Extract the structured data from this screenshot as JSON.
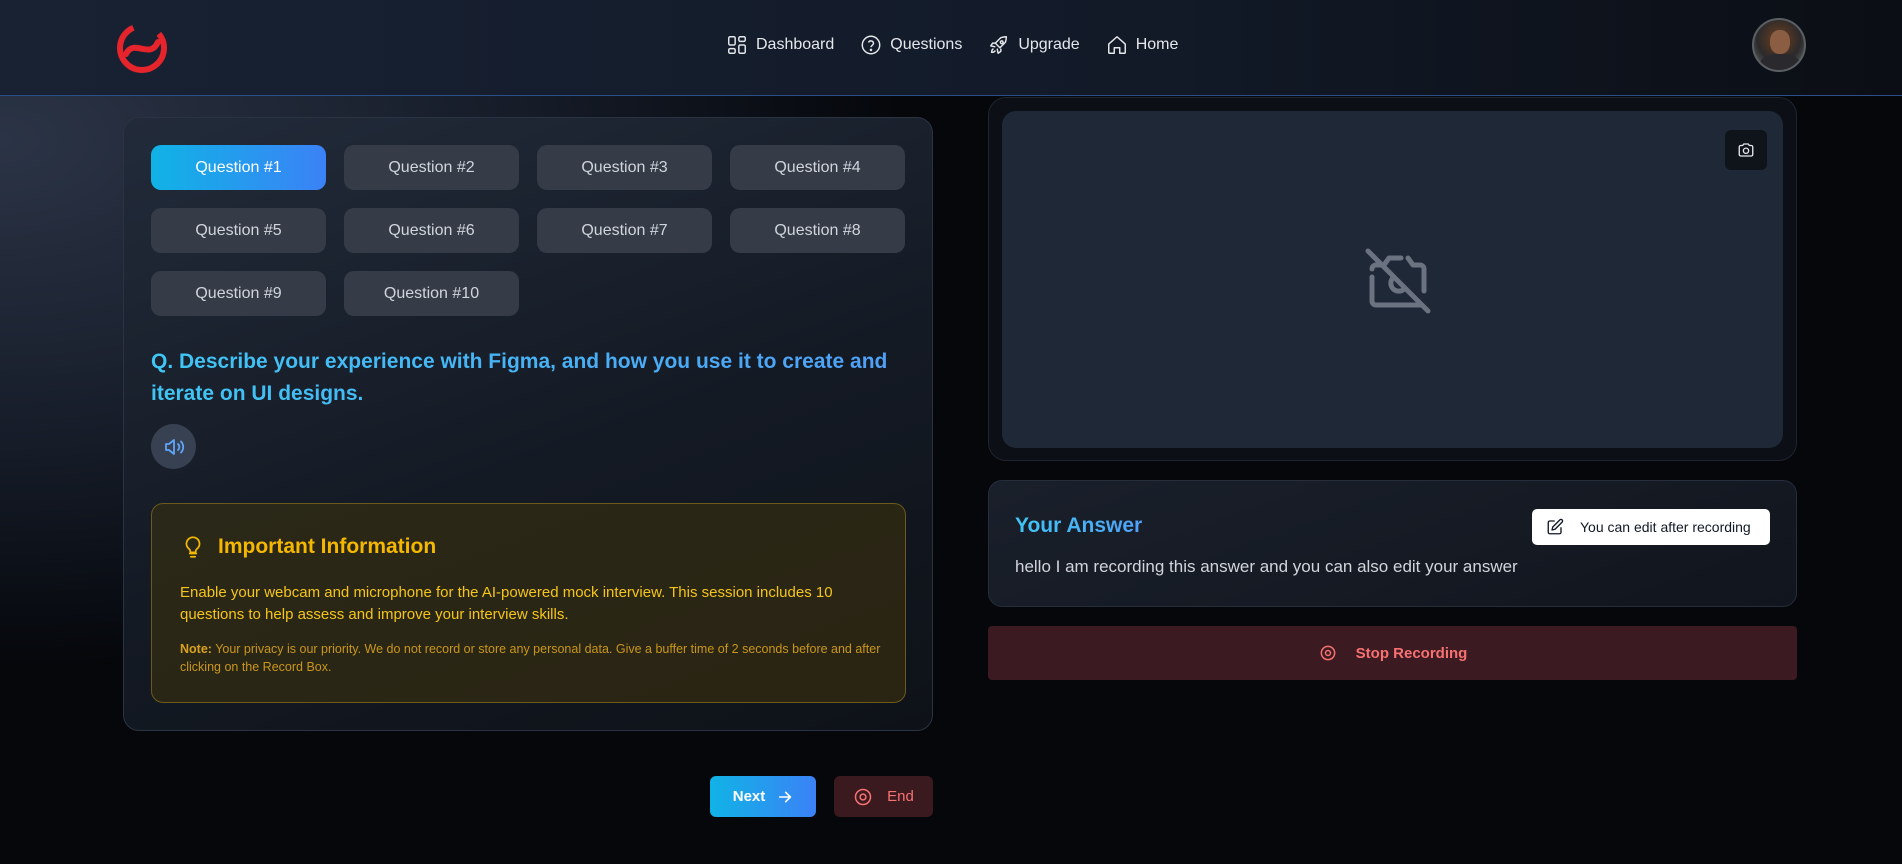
{
  "nav": {
    "links": [
      {
        "label": "Dashboard",
        "icon": "dashboard-icon"
      },
      {
        "label": "Questions",
        "icon": "question-circle-icon"
      },
      {
        "label": "Upgrade",
        "icon": "rocket-icon"
      },
      {
        "label": "Home",
        "icon": "home-icon"
      }
    ]
  },
  "questions": {
    "items": [
      "Question #1",
      "Question #2",
      "Question #3",
      "Question #4",
      "Question #5",
      "Question #6",
      "Question #7",
      "Question #8",
      "Question #9",
      "Question #10"
    ],
    "active_index": 0,
    "current_text": "Q. Describe your experience with Figma, and how you use it to create and iterate on UI designs."
  },
  "info": {
    "title": "Important Information",
    "text": "Enable your webcam and microphone for the AI-powered mock interview. This session includes 10 questions to help assess and improve your interview skills.",
    "note_label": "Note:",
    "note_text": " Your privacy is our priority. We do not record or store any personal data. Give a buffer time of 2 seconds before and after clicking on the Record Box."
  },
  "controls": {
    "next_label": "Next",
    "end_label": "End",
    "stop_label": "Stop Recording"
  },
  "answer": {
    "title": "Your Answer",
    "edit_hint": "You can edit after recording",
    "text": "hello I am recording this answer and you can also edit your answer"
  },
  "colors": {
    "accent_start": "#10b3e6",
    "accent_end": "#3b82f6",
    "warning": "#f5b800",
    "danger": "#f87171",
    "logo": "#e5242b"
  }
}
